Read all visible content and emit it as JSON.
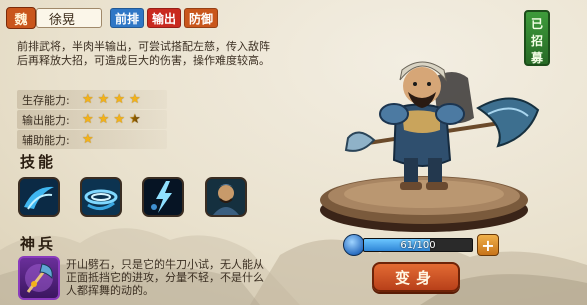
{
  "hero": {
    "kingdom": "魏",
    "name": "徐晃",
    "tags": [
      "前排",
      "输出",
      "防御"
    ],
    "recruited": [
      "已",
      "招",
      "募"
    ],
    "description": "前排武将，半肉半输出，可尝试搭配左慈，传入敌阵后再释放大招，可造成巨大的伤害，操作难度较高。"
  },
  "stats": [
    {
      "label": "生存能力:",
      "stars": 4
    },
    {
      "label": "输出能力:",
      "stars": 3.5
    },
    {
      "label": "辅助能力:",
      "stars": 1
    }
  ],
  "sections": {
    "skills_title": "技能",
    "weapon_title": "神兵"
  },
  "skills": [
    {
      "icon": "water-slash-icon"
    },
    {
      "icon": "whirlwind-icon"
    },
    {
      "icon": "lightning-strike-icon"
    },
    {
      "icon": "warrior-portrait-icon"
    }
  ],
  "weapon": {
    "icon": "divine-axe-icon",
    "description": "开山劈石，只是它的牛刀小试，无人能从正面抵挡它的进攻，分量不轻，不是什么人都挥舞的动的。"
  },
  "exp": {
    "text": "61/100",
    "fraction": 0.61
  },
  "buttons": {
    "plus": "+",
    "transform": "变身"
  },
  "colors": {
    "kingdom": "#c9561c",
    "tag_front": "#2f77c6",
    "tag_output": "#c92a1f",
    "tag_defense": "#c9561c",
    "recruited": "#3e9b3b",
    "star": "#f2b21a",
    "transform": "#e36b33"
  }
}
